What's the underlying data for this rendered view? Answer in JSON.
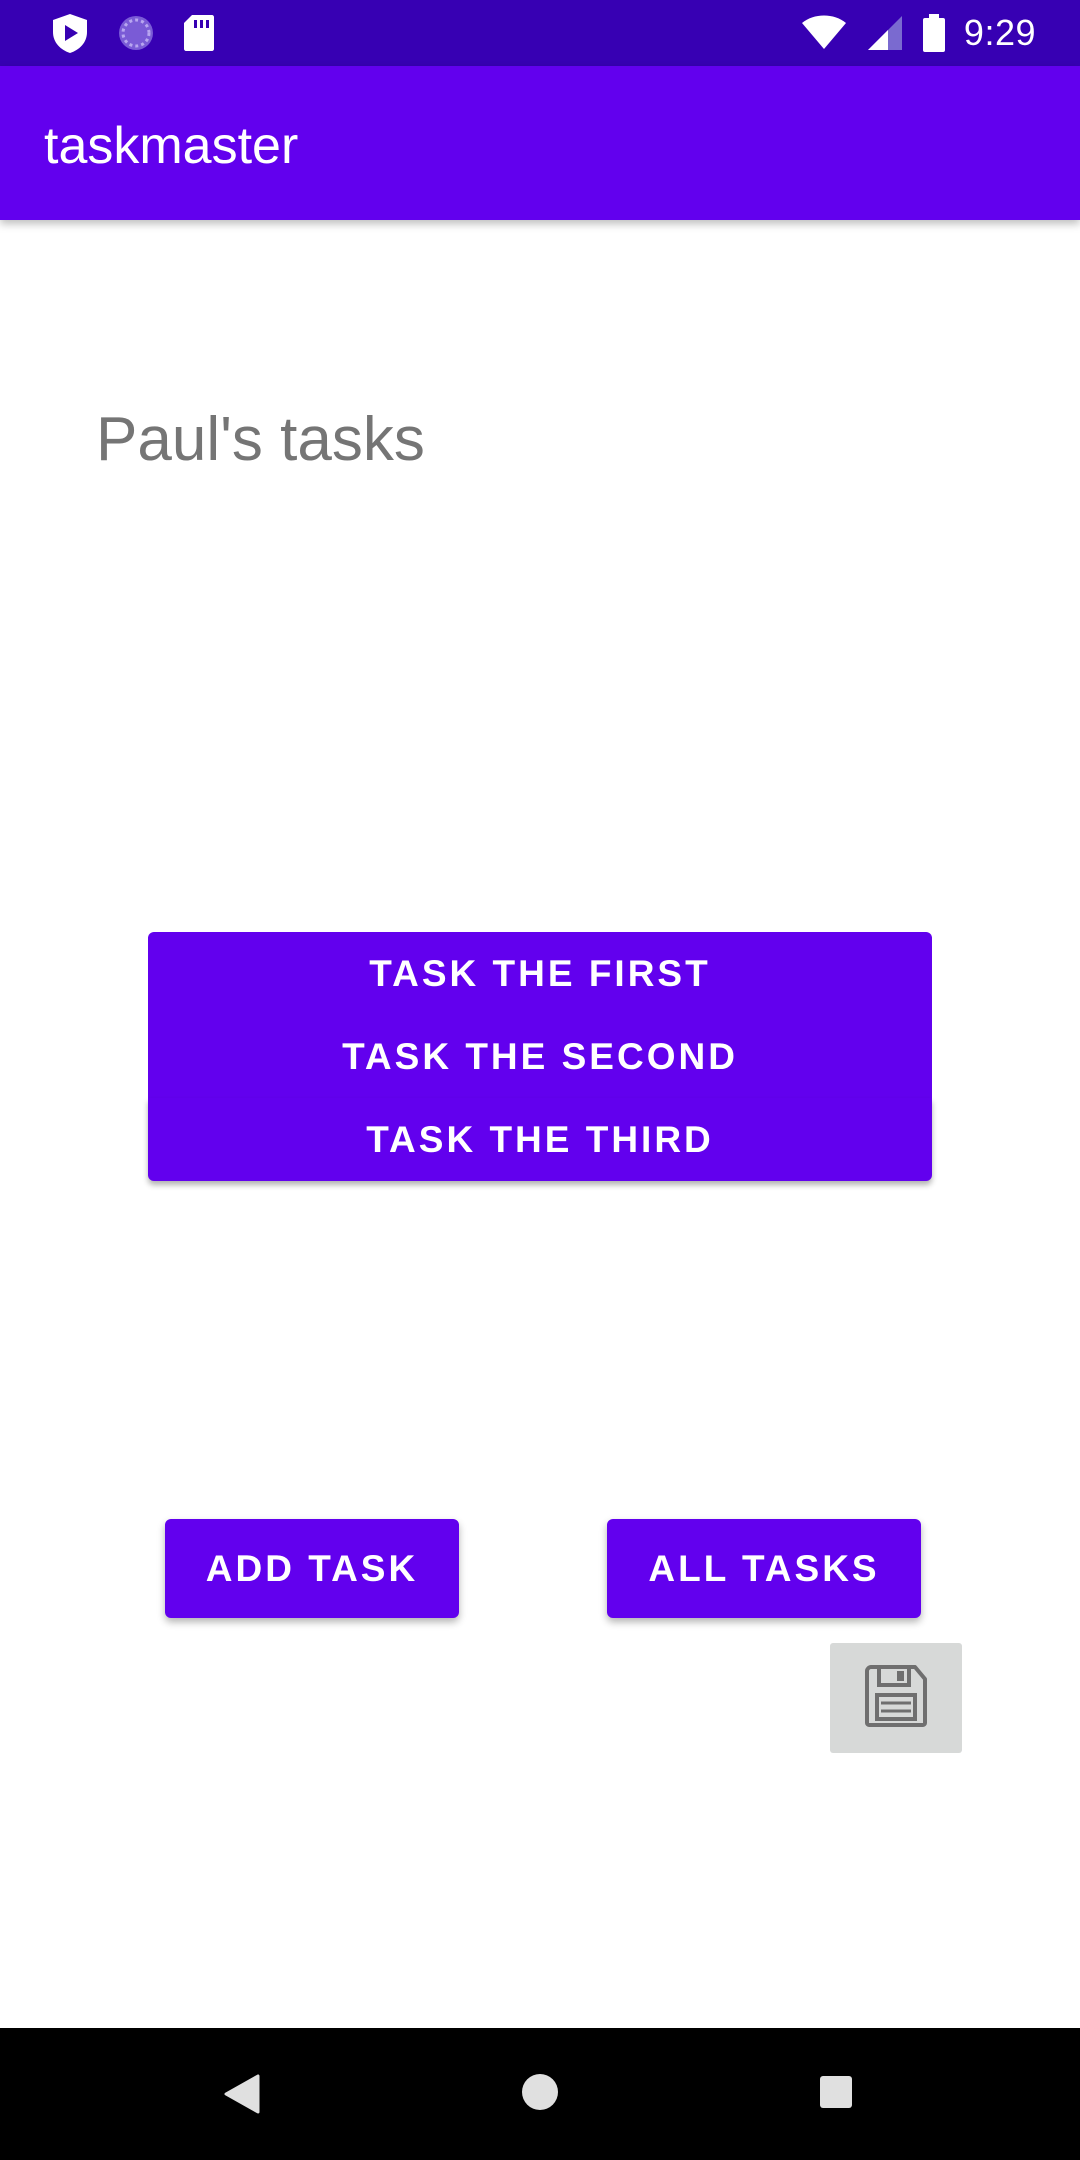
{
  "status_bar": {
    "time": "9:29",
    "left_icons": [
      "shield-play-icon",
      "sync-circle-icon",
      "sd-card-icon"
    ],
    "right_icons": [
      "wifi-icon",
      "cell-signal-icon",
      "battery-icon"
    ]
  },
  "app_bar": {
    "title": "taskmaster"
  },
  "main": {
    "heading": "Paul's tasks",
    "tasks": [
      {
        "label": "TASK THE FIRST"
      },
      {
        "label": "TASK THE SECOND"
      },
      {
        "label": "TASK THE THIRD"
      }
    ],
    "add_task_label": "ADD TASK",
    "all_tasks_label": "ALL TASKS",
    "save_icon": "floppy-disk-icon"
  },
  "nav_bar": {
    "icons": [
      "back-icon",
      "home-icon",
      "recents-icon"
    ]
  },
  "colors": {
    "status_bar": "#3700b3",
    "primary": "#6200ee",
    "heading_text": "#757575",
    "save_button_bg": "#d7d9d8",
    "nav_bar": "#000000"
  }
}
